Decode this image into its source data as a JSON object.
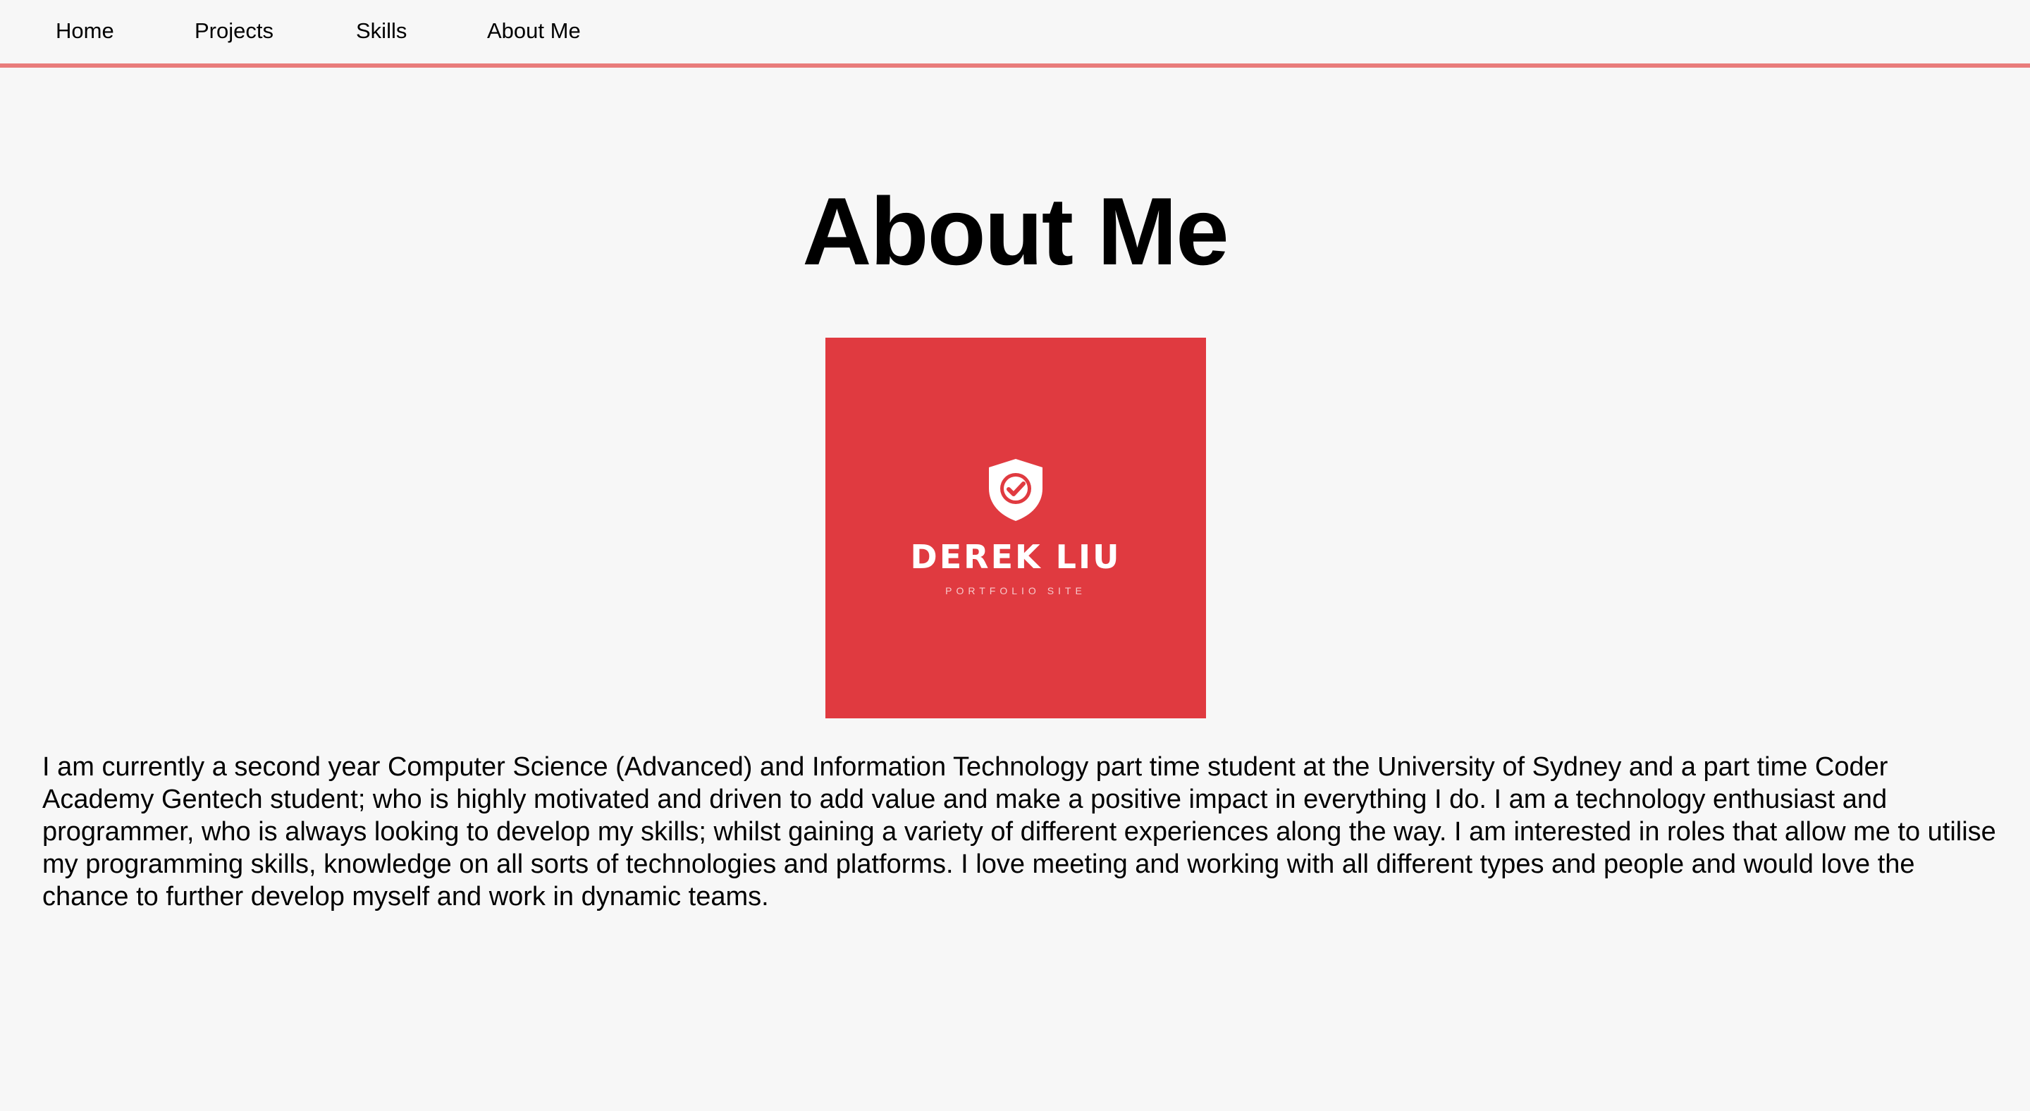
{
  "nav": {
    "items": [
      {
        "label": "Home"
      },
      {
        "label": "Projects"
      },
      {
        "label": "Skills"
      },
      {
        "label": "About Me"
      }
    ],
    "accent_color": "#e97c7b"
  },
  "page": {
    "title": "About Me",
    "background": "#f7f7f7"
  },
  "logo": {
    "name": "DEREK LIU",
    "subtitle": "PORTFOLIO SITE",
    "icon": "shield-check-icon",
    "background": "#e03a40"
  },
  "bio": {
    "text": "I am currently a second year Computer Science (Advanced) and Information Technology part time student at the University of Sydney and a part time Coder Academy Gentech student; who is highly motivated and driven to add value and make a positive impact in everything I do. I am a technology enthusiast and programmer, who is always looking to develop my skills; whilst gaining a variety of different experiences along the way. I am interested in roles that allow me to utilise my programming skills, knowledge on all sorts of technologies and platforms. I love meeting and working with all different types and people and would love the chance to further develop myself and work in dynamic teams."
  }
}
